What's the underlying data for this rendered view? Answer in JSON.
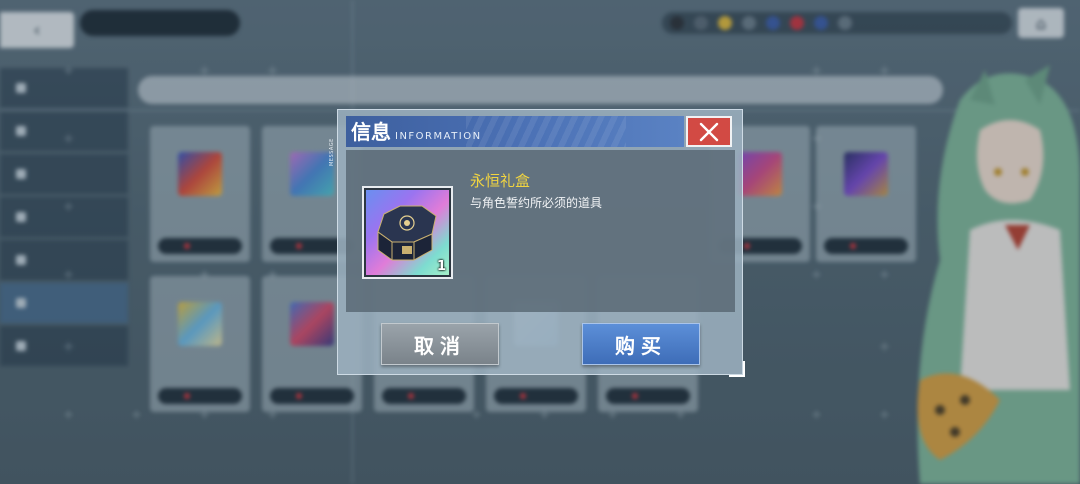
{
  "background": {
    "back_icon": "chevron-left-icon",
    "home_icon": "home-icon",
    "sidebar_items": [
      "",
      "",
      "",
      "",
      "",
      "",
      ""
    ],
    "active_sidebar_index": 5
  },
  "dialog": {
    "title": "信息",
    "title_en": "INFORMATION",
    "side_tag": "MESSAGE",
    "close_icon": "close-icon",
    "item": {
      "name": "永恒礼盒",
      "description": "与角色誓约所必须的道具",
      "count": "1",
      "icon": "gift-box-icon"
    },
    "cancel_label": "取消",
    "buy_label": "购买"
  },
  "colors": {
    "header_blue": "#4c72b6",
    "close_red": "#d24a44",
    "item_name_yellow": "#f2d540",
    "buy_blue": "#3e6db8",
    "cancel_gray": "#7a838a"
  }
}
